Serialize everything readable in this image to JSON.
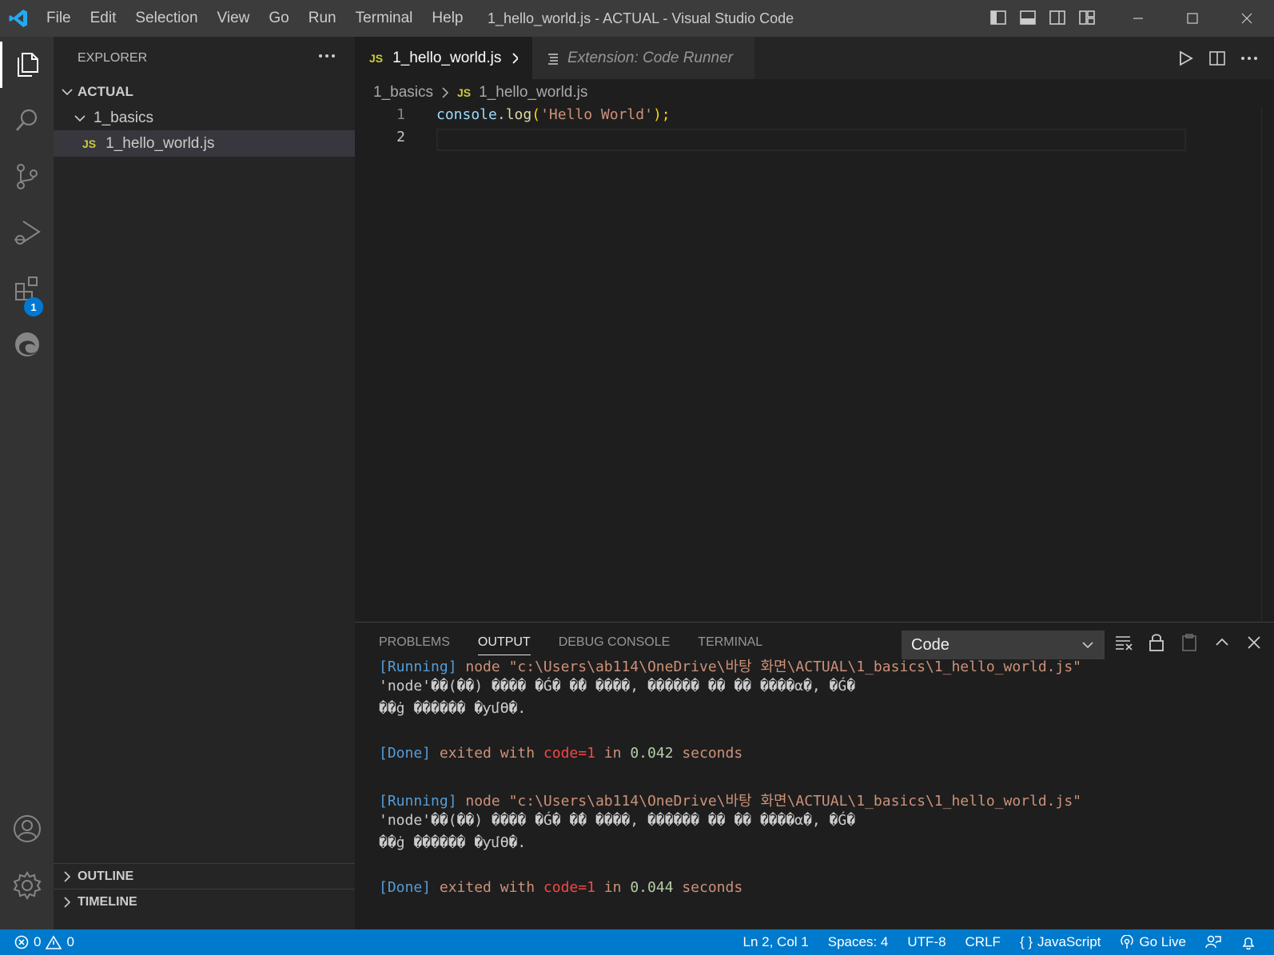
{
  "titlebar": {
    "menu": [
      "File",
      "Edit",
      "Selection",
      "View",
      "Go",
      "Run",
      "Terminal",
      "Help"
    ],
    "window_title": "1_hello_world.js - ACTUAL - Visual Studio Code"
  },
  "activity": {
    "extensions_badge": "1"
  },
  "sidebar": {
    "header": "EXPLORER",
    "root": "ACTUAL",
    "folder": "1_basics",
    "file_icon": "JS",
    "file": "1_hello_world.js",
    "outline": "OUTLINE",
    "timeline": "TIMELINE"
  },
  "tabs": {
    "active_icon": "JS",
    "active": "1_hello_world.js",
    "inactive": "Extension: Code Runner"
  },
  "breadcrumb": {
    "folder": "1_basics",
    "icon": "JS",
    "file": "1_hello_world.js"
  },
  "editor": {
    "lines": [
      "1",
      "2"
    ],
    "code_obj": "console",
    "code_dot": ".",
    "code_fn": "log",
    "code_open": "(",
    "code_str": "'Hello World'",
    "code_close": ");"
  },
  "panel": {
    "tabs": [
      "PROBLEMS",
      "OUTPUT",
      "DEBUG CONSOLE",
      "TERMINAL"
    ],
    "active_tab": "OUTPUT",
    "channel": "Code",
    "runs": [
      {
        "running_tag": "[Running]",
        "cmd": " node \"c:\\Users\\ab114\\OneDrive\\바탕 화면\\ACTUAL\\1_basics\\1_hello_world.js\"",
        "err1": "'node'��(��) ���� �Ǵ� �ܺ� ����, ������ �� �� ����α�, �Ǵ�",
        "err2": "��ġ ������ �ƴմϴ�.",
        "done_tag": "[Done]",
        "exited": " exited with ",
        "code": "code=1",
        "in": " in ",
        "time": "0.042",
        "seconds": " seconds"
      },
      {
        "running_tag": "[Running]",
        "cmd": " node \"c:\\Users\\ab114\\OneDrive\\바탕 화면\\ACTUAL\\1_basics\\1_hello_world.js\"",
        "err1": "'node'��(��) ���� �Ǵ� �ܺ� ����, ������ �� �� ����α�, �Ǵ�",
        "err2": "��ġ ������ �ƴմϴ�.",
        "done_tag": "[Done]",
        "exited": " exited with ",
        "code": "code=1",
        "in": " in ",
        "time": "0.044",
        "seconds": " seconds"
      }
    ]
  },
  "statusbar": {
    "errors": "0",
    "warnings": "0",
    "position": "Ln 2, Col 1",
    "spaces": "Spaces: 4",
    "encoding": "UTF-8",
    "eol": "CRLF",
    "language": "JavaScript",
    "golive": "Go Live"
  },
  "colors": {
    "accent": "#007acc",
    "titlebar": "#3c3c3c",
    "activitybar": "#333333",
    "sidebar": "#252526",
    "editor": "#1e1e1e"
  }
}
